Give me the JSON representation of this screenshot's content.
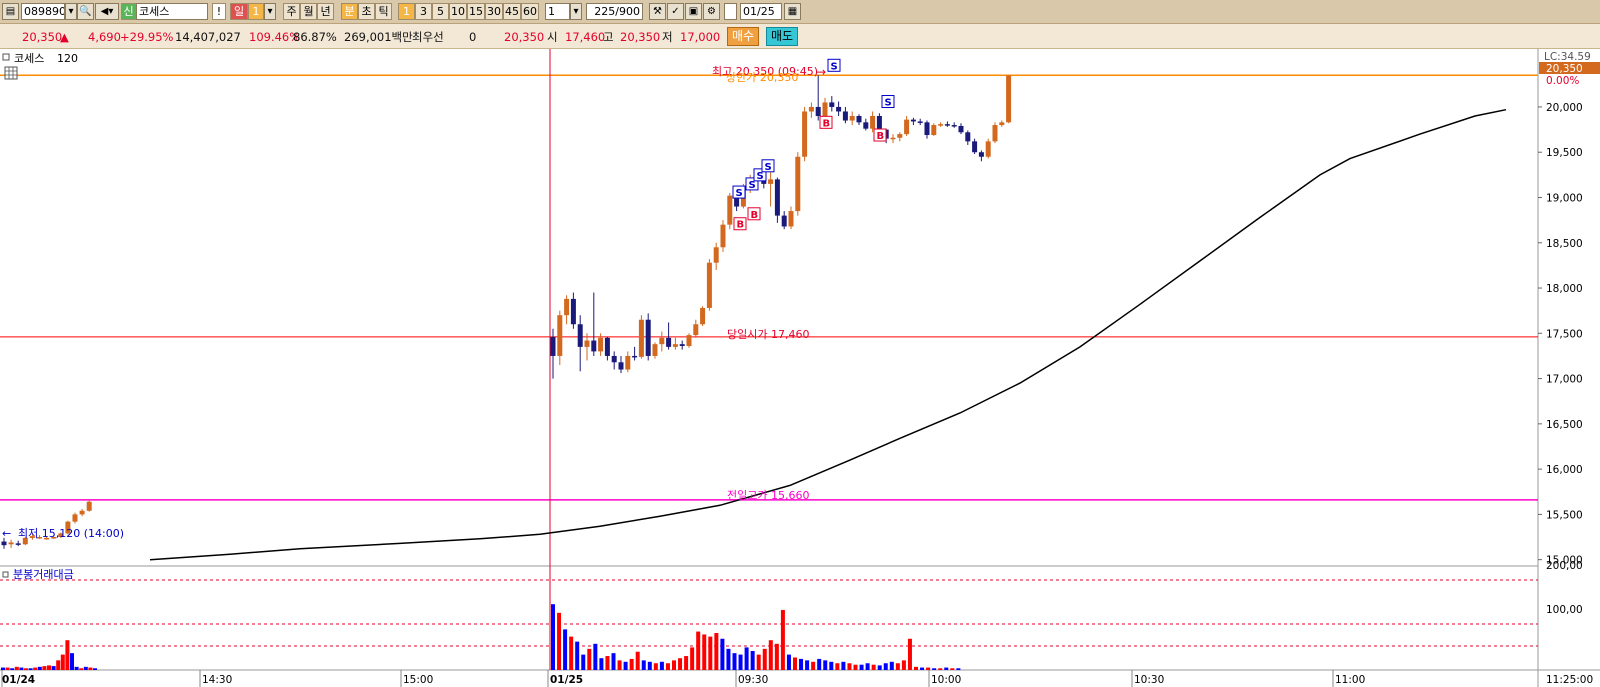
{
  "toolbar": {
    "code": "089890",
    "credit_badge": "신",
    "name": "코세스",
    "alert": "!",
    "period_day": "일",
    "period_num": "1",
    "period_week": "주",
    "period_month": "월",
    "period_year": "년",
    "period_min": "분",
    "period_sec": "초",
    "period_tick": "틱",
    "intervals": [
      "1",
      "3",
      "5",
      "10",
      "15",
      "30",
      "45",
      "60"
    ],
    "count_select": "1",
    "bar_count": "225/900",
    "date": "01/25"
  },
  "infobar": {
    "price": "20,350",
    "change": "4,690",
    "change_pct": "+29.95%",
    "volume": "14,407,027",
    "vol_ratio": "109.46%",
    "turnover": "86.87%",
    "amount": "269,001백만",
    "priority_label": "최우선",
    "priority_value": "0",
    "current": "20,350",
    "open_label": "시",
    "open": "17,460",
    "high_label": "고",
    "high": "20,350",
    "low_label": "저",
    "low": "17,000",
    "buy_label": "매수",
    "sell_label": "매도"
  },
  "chart_panel": {
    "title": "코세스",
    "period": "120",
    "lc_label": "LC:34.59",
    "current_price_tag": "20,350",
    "pct_tag": "0.00%",
    "annotations": {
      "high": "최고 20,350 (09:45)",
      "upper_limit": "상한가 20,350",
      "open": "당일시가 17,460",
      "prev_high": "전일고가 15,660",
      "low": "최저 15,120 (14:00)"
    },
    "signal_buy": "B",
    "signal_sell": "S"
  },
  "volume_panel": {
    "title": "분봉거래대금",
    "y_ticks": [
      "200,00",
      "100,00"
    ]
  },
  "colors": {
    "up": "#d2691e",
    "down": "#1a1a7a",
    "ma": "#000000",
    "open_line": "#ff0000",
    "prev_high_line": "#ff00cc",
    "high_line": "#ff8c00",
    "vol_up": "#ff0000",
    "vol_down": "#0000ff"
  },
  "chart_data": {
    "type": "candlestick",
    "y_ticks": [
      "20,000",
      "19,500",
      "19,000",
      "18,500",
      "18,000",
      "17,500",
      "17,000",
      "16,500",
      "16,000",
      "15,500",
      "15,000"
    ],
    "ylim": [
      14930,
      20640
    ],
    "x_ticks": [
      "01/24",
      "14:30",
      "15:00",
      "01/25",
      "09:30",
      "10:00",
      "10:30",
      "11:00",
      "11:25:00"
    ],
    "levels": {
      "high": 20350,
      "open": 17460,
      "prev_high": 15660,
      "low": 15120
    },
    "candles": [
      {
        "o": 15200,
        "h": 15240,
        "l": 15120,
        "c": 15160
      },
      {
        "o": 15170,
        "h": 15220,
        "l": 15130,
        "c": 15190
      },
      {
        "o": 15180,
        "h": 15210,
        "l": 15150,
        "c": 15170
      },
      {
        "o": 15170,
        "h": 15250,
        "l": 15160,
        "c": 15240
      },
      {
        "o": 15240,
        "h": 15280,
        "l": 15220,
        "c": 15260
      },
      {
        "o": 15250,
        "h": 15270,
        "l": 15230,
        "c": 15250
      },
      {
        "o": 15240,
        "h": 15260,
        "l": 15220,
        "c": 15240
      },
      {
        "o": 15240,
        "h": 15260,
        "l": 15230,
        "c": 15250
      },
      {
        "o": 15250,
        "h": 15300,
        "l": 15240,
        "c": 15290
      },
      {
        "o": 15290,
        "h": 15430,
        "l": 15280,
        "c": 15420
      },
      {
        "o": 15420,
        "h": 15520,
        "l": 15400,
        "c": 15500
      },
      {
        "o": 15500,
        "h": 15560,
        "l": 15480,
        "c": 15540
      },
      {
        "o": 15540,
        "h": 15660,
        "l": 15530,
        "c": 15640
      },
      {
        "o": 17460,
        "h": 17550,
        "l": 17000,
        "c": 17250
      },
      {
        "o": 17250,
        "h": 17750,
        "l": 17150,
        "c": 17700
      },
      {
        "o": 17700,
        "h": 17920,
        "l": 17600,
        "c": 17880
      },
      {
        "o": 17880,
        "h": 17950,
        "l": 17550,
        "c": 17600
      },
      {
        "o": 17600,
        "h": 17700,
        "l": 17080,
        "c": 17350
      },
      {
        "o": 17350,
        "h": 17500,
        "l": 17200,
        "c": 17420
      },
      {
        "o": 17420,
        "h": 17950,
        "l": 17250,
        "c": 17300
      },
      {
        "o": 17300,
        "h": 17500,
        "l": 17250,
        "c": 17450
      },
      {
        "o": 17450,
        "h": 17460,
        "l": 17200,
        "c": 17250
      },
      {
        "o": 17250,
        "h": 17300,
        "l": 17100,
        "c": 17180
      },
      {
        "o": 17180,
        "h": 17250,
        "l": 17060,
        "c": 17100
      },
      {
        "o": 17100,
        "h": 17300,
        "l": 17070,
        "c": 17250
      },
      {
        "o": 17250,
        "h": 17350,
        "l": 17200,
        "c": 17240
      },
      {
        "o": 17240,
        "h": 17700,
        "l": 17220,
        "c": 17650
      },
      {
        "o": 17650,
        "h": 17720,
        "l": 17200,
        "c": 17250
      },
      {
        "o": 17250,
        "h": 17400,
        "l": 17220,
        "c": 17380
      },
      {
        "o": 17380,
        "h": 17520,
        "l": 17300,
        "c": 17450
      },
      {
        "o": 17450,
        "h": 17620,
        "l": 17320,
        "c": 17350
      },
      {
        "o": 17350,
        "h": 17450,
        "l": 17320,
        "c": 17380
      },
      {
        "o": 17380,
        "h": 17420,
        "l": 17320,
        "c": 17360
      },
      {
        "o": 17360,
        "h": 17500,
        "l": 17340,
        "c": 17480
      },
      {
        "o": 17480,
        "h": 17650,
        "l": 17450,
        "c": 17600
      },
      {
        "o": 17600,
        "h": 17800,
        "l": 17580,
        "c": 17780
      },
      {
        "o": 17780,
        "h": 18320,
        "l": 17750,
        "c": 18280
      },
      {
        "o": 18280,
        "h": 18500,
        "l": 18200,
        "c": 18450
      },
      {
        "o": 18450,
        "h": 18750,
        "l": 18400,
        "c": 18700
      },
      {
        "o": 18700,
        "h": 19050,
        "l": 18650,
        "c": 19020
      },
      {
        "o": 19020,
        "h": 19060,
        "l": 18850,
        "c": 18900
      },
      {
        "o": 18900,
        "h": 19150,
        "l": 18880,
        "c": 19100
      },
      {
        "o": 19100,
        "h": 19250,
        "l": 19050,
        "c": 19200
      },
      {
        "o": 19200,
        "h": 19300,
        "l": 19150,
        "c": 19280
      },
      {
        "o": 19280,
        "h": 19300,
        "l": 19100,
        "c": 19150
      },
      {
        "o": 19150,
        "h": 19350,
        "l": 18900,
        "c": 19200
      },
      {
        "o": 19200,
        "h": 19220,
        "l": 18720,
        "c": 18800
      },
      {
        "o": 18800,
        "h": 18850,
        "l": 18650,
        "c": 18680
      },
      {
        "o": 18680,
        "h": 18900,
        "l": 18650,
        "c": 18850
      },
      {
        "o": 18850,
        "h": 19500,
        "l": 18800,
        "c": 19450
      },
      {
        "o": 19450,
        "h": 20000,
        "l": 19400,
        "c": 19950
      },
      {
        "o": 19950,
        "h": 20050,
        "l": 19880,
        "c": 20000
      },
      {
        "o": 20000,
        "h": 20350,
        "l": 19850,
        "c": 19900
      },
      {
        "o": 19900,
        "h": 20100,
        "l": 19880,
        "c": 20050
      },
      {
        "o": 20050,
        "h": 20120,
        "l": 19950,
        "c": 20000
      },
      {
        "o": 20000,
        "h": 20060,
        "l": 19900,
        "c": 19950
      },
      {
        "o": 19950,
        "h": 20000,
        "l": 19820,
        "c": 19850
      },
      {
        "o": 19850,
        "h": 19950,
        "l": 19800,
        "c": 19900
      },
      {
        "o": 19900,
        "h": 19920,
        "l": 19800,
        "c": 19830
      },
      {
        "o": 19830,
        "h": 19870,
        "l": 19740,
        "c": 19760
      },
      {
        "o": 19760,
        "h": 19950,
        "l": 19720,
        "c": 19900
      },
      {
        "o": 19900,
        "h": 19930,
        "l": 19720,
        "c": 19750
      },
      {
        "o": 19750,
        "h": 19760,
        "l": 19600,
        "c": 19650
      },
      {
        "o": 19650,
        "h": 19700,
        "l": 19600,
        "c": 19660
      },
      {
        "o": 19660,
        "h": 19720,
        "l": 19620,
        "c": 19700
      },
      {
        "o": 19700,
        "h": 19900,
        "l": 19680,
        "c": 19860
      },
      {
        "o": 19860,
        "h": 19880,
        "l": 19800,
        "c": 19840
      },
      {
        "o": 19840,
        "h": 19870,
        "l": 19800,
        "c": 19830
      },
      {
        "o": 19830,
        "h": 19850,
        "l": 19650,
        "c": 19690
      },
      {
        "o": 19690,
        "h": 19820,
        "l": 19680,
        "c": 19800
      },
      {
        "o": 19800,
        "h": 19830,
        "l": 19780,
        "c": 19810
      },
      {
        "o": 19810,
        "h": 19840,
        "l": 19780,
        "c": 19800
      },
      {
        "o": 19800,
        "h": 19830,
        "l": 19770,
        "c": 19790
      },
      {
        "o": 19790,
        "h": 19820,
        "l": 19700,
        "c": 19720
      },
      {
        "o": 19720,
        "h": 19740,
        "l": 19580,
        "c": 19620
      },
      {
        "o": 19620,
        "h": 19650,
        "l": 19480,
        "c": 19500
      },
      {
        "o": 19500,
        "h": 19520,
        "l": 19400,
        "c": 19450
      },
      {
        "o": 19450,
        "h": 19650,
        "l": 19430,
        "c": 19620
      },
      {
        "o": 19620,
        "h": 19830,
        "l": 19600,
        "c": 19800
      },
      {
        "o": 19800,
        "h": 19850,
        "l": 19780,
        "c": 19830
      },
      {
        "o": 19830,
        "h": 20350,
        "l": 19820,
        "c": 20350
      }
    ],
    "ma_series": [
      [
        150,
        15000
      ],
      [
        230,
        15060
      ],
      [
        300,
        15120
      ],
      [
        400,
        15180
      ],
      [
        480,
        15230
      ],
      [
        540,
        15280
      ],
      [
        600,
        15370
      ],
      [
        660,
        15480
      ],
      [
        720,
        15600
      ],
      [
        790,
        15820
      ],
      [
        850,
        16100
      ],
      [
        900,
        16340
      ],
      [
        960,
        16620
      ],
      [
        1020,
        16950
      ],
      [
        1080,
        17350
      ],
      [
        1140,
        17820
      ],
      [
        1200,
        18300
      ],
      [
        1260,
        18780
      ],
      [
        1320,
        19250
      ],
      [
        1350,
        19430
      ],
      [
        1420,
        19700
      ],
      [
        1475,
        19900
      ],
      [
        1506,
        19970
      ]
    ],
    "volume": [
      {
        "v": 2,
        "up": false
      },
      {
        "v": 2,
        "up": true
      },
      {
        "v": 1,
        "up": false
      },
      {
        "v": 3,
        "up": true
      },
      {
        "v": 2,
        "up": false
      },
      {
        "v": 1,
        "up": true
      },
      {
        "v": 1,
        "up": false
      },
      {
        "v": 2,
        "up": true
      },
      {
        "v": 3,
        "up": false
      },
      {
        "v": 4,
        "up": true
      },
      {
        "v": 5,
        "up": true
      },
      {
        "v": 4,
        "up": false
      },
      {
        "v": 12,
        "up": true
      },
      {
        "v": 20,
        "up": true
      },
      {
        "v": 40,
        "up": true
      },
      {
        "v": 22,
        "up": false
      },
      {
        "v": 3,
        "up": false
      },
      {
        "v": 1,
        "up": true
      },
      {
        "v": 3,
        "up": false
      },
      {
        "v": 2,
        "up": true
      },
      {
        "v": 1,
        "up": false
      },
      {
        "v": 90,
        "up": false
      },
      {
        "v": 78,
        "up": true
      },
      {
        "v": 55,
        "up": false
      },
      {
        "v": 45,
        "up": true
      },
      {
        "v": 38,
        "up": false
      },
      {
        "v": 20,
        "up": false
      },
      {
        "v": 28,
        "up": true
      },
      {
        "v": 35,
        "up": false
      },
      {
        "v": 15,
        "up": false
      },
      {
        "v": 18,
        "up": true
      },
      {
        "v": 22,
        "up": false
      },
      {
        "v": 12,
        "up": true
      },
      {
        "v": 10,
        "up": false
      },
      {
        "v": 14,
        "up": true
      },
      {
        "v": 24,
        "up": true
      },
      {
        "v": 12,
        "up": false
      },
      {
        "v": 10,
        "up": false
      },
      {
        "v": 8,
        "up": true
      },
      {
        "v": 10,
        "up": false
      },
      {
        "v": 8,
        "up": true
      },
      {
        "v": 12,
        "up": true
      },
      {
        "v": 15,
        "up": true
      },
      {
        "v": 18,
        "up": true
      },
      {
        "v": 30,
        "up": true
      },
      {
        "v": 52,
        "up": true
      },
      {
        "v": 48,
        "up": true
      },
      {
        "v": 45,
        "up": true
      },
      {
        "v": 50,
        "up": true
      },
      {
        "v": 42,
        "up": false
      },
      {
        "v": 28,
        "up": false
      },
      {
        "v": 22,
        "up": false
      },
      {
        "v": 20,
        "up": false
      },
      {
        "v": 30,
        "up": false
      },
      {
        "v": 25,
        "up": false
      },
      {
        "v": 20,
        "up": true
      },
      {
        "v": 28,
        "up": true
      },
      {
        "v": 40,
        "up": true
      },
      {
        "v": 35,
        "up": true
      },
      {
        "v": 82,
        "up": true
      },
      {
        "v": 20,
        "up": false
      },
      {
        "v": 16,
        "up": true
      },
      {
        "v": 14,
        "up": false
      },
      {
        "v": 12,
        "up": false
      },
      {
        "v": 10,
        "up": true
      },
      {
        "v": 14,
        "up": false
      },
      {
        "v": 12,
        "up": false
      },
      {
        "v": 10,
        "up": false
      },
      {
        "v": 8,
        "up": true
      },
      {
        "v": 10,
        "up": false
      },
      {
        "v": 8,
        "up": true
      },
      {
        "v": 6,
        "up": true
      },
      {
        "v": 6,
        "up": false
      },
      {
        "v": 8,
        "up": false
      },
      {
        "v": 6,
        "up": true
      },
      {
        "v": 5,
        "up": false
      },
      {
        "v": 8,
        "up": false
      },
      {
        "v": 10,
        "up": false
      },
      {
        "v": 8,
        "up": true
      },
      {
        "v": 12,
        "up": true
      },
      {
        "v": 42,
        "up": true
      },
      {
        "v": 3,
        "up": true
      },
      {
        "v": 2,
        "up": false
      },
      {
        "v": 2,
        "up": true
      },
      {
        "v": 1,
        "up": false
      },
      {
        "v": 1,
        "up": true
      },
      {
        "v": 2,
        "up": false
      },
      {
        "v": 1,
        "up": true
      },
      {
        "v": 1,
        "up": false
      }
    ]
  }
}
